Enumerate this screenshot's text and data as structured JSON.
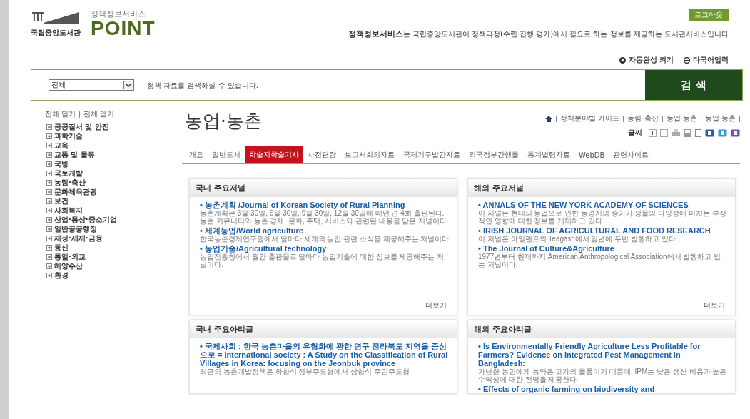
{
  "header": {
    "library_name": "국립중앙도서관",
    "service_name": "정책정보서비스",
    "brand": "POINT",
    "logout_button": "로그아웃",
    "tagline": "**정책정보서비스**는 국립중앙도서관이 정책과정(수립·집행·평가)에서 필요로 하는 정보를 제공하는 도서관서비스입니다"
  },
  "search_options": [
    {
      "kind": "autocomplete",
      "label": "자동완성 켜기"
    },
    {
      "kind": "multilingual",
      "label": "다국어입력"
    }
  ],
  "search": {
    "scope": "전체",
    "placeholder": "정책 자료를 검색하실 수 있습니다.",
    "button": "검 색"
  },
  "sidebar": {
    "toggles": [
      "전체 닫기",
      "전체 열기"
    ],
    "items": [
      {
        "label": "공공질서 및 안전",
        "expanded": false
      },
      {
        "label": "과학기술",
        "expanded": false
      },
      {
        "label": "교육",
        "expanded": false
      },
      {
        "label": "교통 및 물류",
        "expanded": false
      },
      {
        "label": "국방",
        "expanded": false
      },
      {
        "label": "국토개발",
        "expanded": false
      },
      {
        "label": "농림·축산",
        "expanded": false
      },
      {
        "label": "문화체육관광",
        "expanded": false
      },
      {
        "label": "보건",
        "expanded": false
      },
      {
        "label": "사회복지",
        "expanded": false
      },
      {
        "label": "산업·통상·중소기업",
        "expanded": false
      },
      {
        "label": "일반공공행정",
        "expanded": false
      },
      {
        "label": "재정·세제·금융",
        "expanded": false
      },
      {
        "label": "통신",
        "expanded": false
      },
      {
        "label": "통일·외교",
        "expanded": false
      },
      {
        "label": "해양수산",
        "expanded": false
      },
      {
        "label": "환경",
        "expanded": false
      }
    ]
  },
  "page": {
    "title": "농업·농촌",
    "breadcrumb": [
      "정책분야별 가이드",
      "농림·축산",
      "농업·농촌",
      "농업·농촌"
    ],
    "font_size_label": "글씨"
  },
  "tabs": [
    {
      "label": "개요",
      "selected": false
    },
    {
      "label": "일반도서",
      "selected": false
    },
    {
      "label": "학술지학술기사",
      "selected": true
    },
    {
      "label": "사전편람",
      "selected": false
    },
    {
      "label": "보고서회의자료",
      "selected": false
    },
    {
      "label": "국제기구발간자료",
      "selected": false
    },
    {
      "label": "외국정부간행물",
      "selected": false
    },
    {
      "label": "통계법령자료",
      "selected": false
    },
    {
      "label": "WebDB",
      "selected": false
    },
    {
      "label": "관련사이트",
      "selected": false
    }
  ],
  "panels": [
    {
      "title": "국내 주요저널",
      "more": "-더보기",
      "items": [
        {
          "title": "• 농촌계획 /Journal of Korean Society of Rural Planning",
          "description": "농촌계획은 3월 30일, 6월 30일, 9월 30일, 12월 30일에 매년 연 4회 출판된다. 농촌 커뮤니티와 농촌 경제, 문화, 주택, 서비스와 관련된 내용을 담은 저널이다."
        },
        {
          "title": "• 세계농업/World agriculture",
          "description": "한국농촌경제연구원에서 달마다 세계의 농업 관련 소식을 제공해주는 저널이다"
        },
        {
          "title": "• 농업기술/Agricultural technology",
          "description": "농업진흥청에서 월간 출판물로 달마다 농업기술에 대한 정보를 제공해주는 저널이다."
        }
      ]
    },
    {
      "title": "해외 주요저널",
      "more": "-더보기",
      "items": [
        {
          "title": "• ANNALS OF THE NEW YORK ACADEMY OF SCIENCES",
          "description": "이 저널은 현대의 농업으로 인한 농경지의 증가가 생물의 다양성에 미치는 부정적인 영향에 대한 정보를 게재하고 있다"
        },
        {
          "title": "• IRISH JOURNAL OF AGRICULTURAL AND FOOD RESEARCH",
          "description": "이 저널은 아일랜드의 Teagasc에서 일년에 두번 발행하고 있다."
        },
        {
          "title": "• The Journal of Culture&Agriculture",
          "description": "1977년부터 현재까지 American Anthropological Association에서 발행하고 있는 저널이다."
        }
      ]
    },
    {
      "title": "국내 주요아티클",
      "items": [
        {
          "title": "• 국제사회 : 한국 농촌마을의 유형화에 관한 연구 전라북도 지역을 중심으로 = International society : A Study on the Classification of Rural Villages in Korea: focusing on the Jeonbuk province",
          "description": "최근의 농촌개발정책은 하향식 정부주도형에서 상향식 주민주도형"
        }
      ]
    },
    {
      "title": "해외 주요아티클",
      "items": [
        {
          "title": "• Is Environmentally Friendly Agriculture Less Profitable for Farmers? Evidence on Integrated Pest Management in Bangladesh:",
          "description": "가난한 농민에게 농약은 고가의 물품이기 때문에, IPM는 낮은 생산 비용과 높은 수익성에 대한 전망을 제공한다"
        },
        {
          "title": "• Effects of organic farming on biodiversity and"
        }
      ]
    }
  ]
}
